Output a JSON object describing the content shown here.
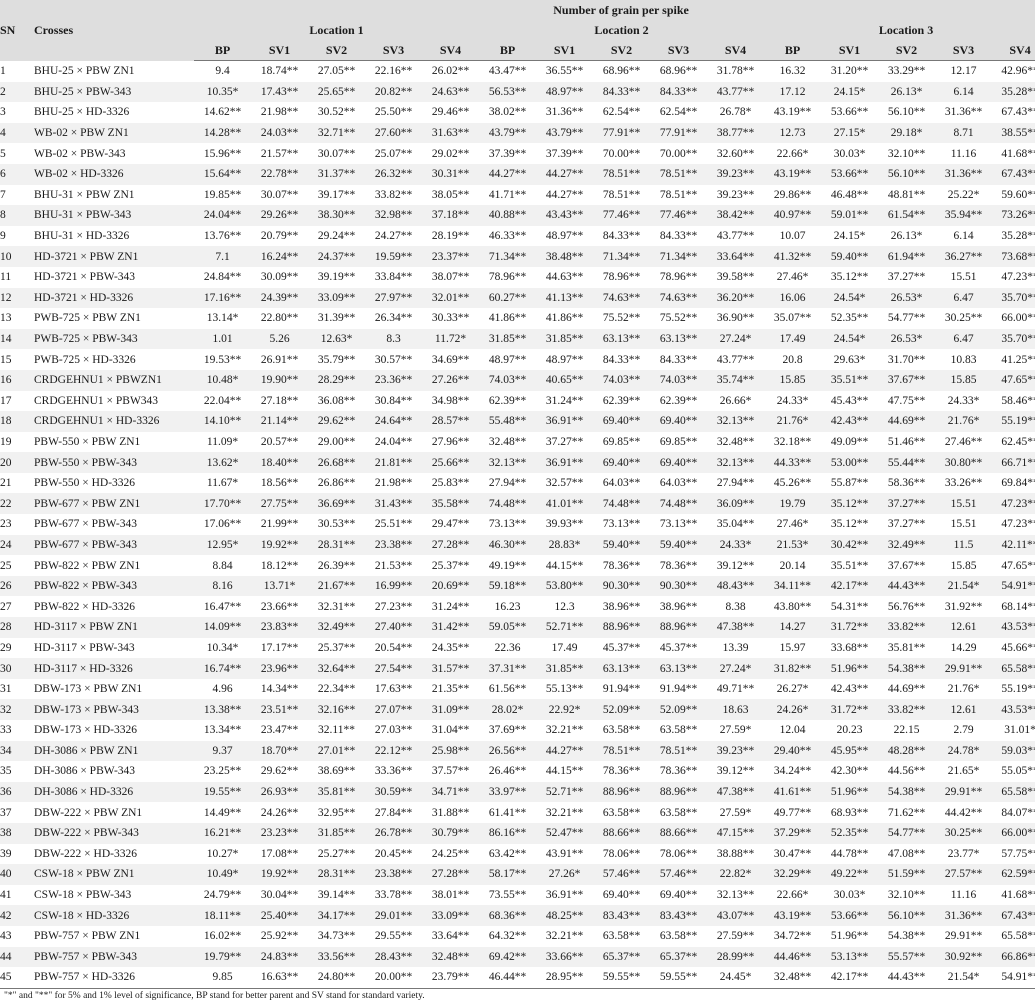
{
  "table": {
    "title": "Number of grain per spike",
    "sn_header": "SN",
    "crosses_header": "Crosses",
    "locations": [
      "Location 1",
      "Location 2",
      "Location 3"
    ],
    "columns": [
      "BP",
      "SV1",
      "SV2",
      "SV3",
      "SV4"
    ],
    "rows": [
      [
        "1",
        "BHU-25 × PBW ZN1",
        "9.4",
        "18.74**",
        "27.05**",
        "22.16**",
        "26.02**",
        "43.47**",
        "36.55**",
        "68.96**",
        "68.96**",
        "31.78**",
        "16.32",
        "31.20**",
        "33.29**",
        "12.17",
        "42.96**"
      ],
      [
        "2",
        "BHU-25 × PBW-343",
        "10.35*",
        "17.43**",
        "25.65**",
        "20.82**",
        "24.63**",
        "56.53**",
        "48.97**",
        "84.33**",
        "84.33**",
        "43.77**",
        "17.12",
        "24.15*",
        "26.13*",
        "6.14",
        "35.28**"
      ],
      [
        "3",
        "BHU-25 × HD-3326",
        "14.62**",
        "21.98**",
        "30.52**",
        "25.50**",
        "29.46**",
        "38.02**",
        "31.36**",
        "62.54**",
        "62.54**",
        "26.78*",
        "43.19**",
        "53.66**",
        "56.10**",
        "31.36**",
        "67.43**"
      ],
      [
        "4",
        "WB-02 × PBW ZN1",
        "14.28**",
        "24.03**",
        "32.71**",
        "27.60**",
        "31.63**",
        "43.79**",
        "43.79**",
        "77.91**",
        "77.91**",
        "38.77**",
        "12.73",
        "27.15*",
        "29.18*",
        "8.71",
        "38.55**"
      ],
      [
        "5",
        "WB-02 × PBW-343",
        "15.96**",
        "21.57**",
        "30.07**",
        "25.07**",
        "29.02**",
        "37.39**",
        "37.39**",
        "70.00**",
        "70.00**",
        "32.60**",
        "22.66*",
        "30.03*",
        "32.10**",
        "11.16",
        "41.68**"
      ],
      [
        "6",
        "WB-02 × HD-3326",
        "15.64**",
        "22.78**",
        "31.37**",
        "26.32**",
        "30.31**",
        "44.27**",
        "44.27**",
        "78.51**",
        "78.51**",
        "39.23**",
        "43.19**",
        "53.66**",
        "56.10**",
        "31.36**",
        "67.43**"
      ],
      [
        "7",
        "BHU-31 × PBW ZN1",
        "19.85**",
        "30.07**",
        "39.17**",
        "33.82**",
        "38.05**",
        "41.71**",
        "44.27**",
        "78.51**",
        "78.51**",
        "39.23**",
        "29.86**",
        "46.48**",
        "48.81**",
        "25.22*",
        "59.60**"
      ],
      [
        "8",
        "BHU-31 × PBW-343",
        "24.04**",
        "29.26**",
        "38.30**",
        "32.98**",
        "37.18**",
        "40.88**",
        "43.43**",
        "77.46**",
        "77.46**",
        "38.42**",
        "40.97**",
        "59.01**",
        "61.54**",
        "35.94**",
        "73.26**"
      ],
      [
        "9",
        "BHU-31 × HD-3326",
        "13.76**",
        "20.79**",
        "29.24**",
        "24.27**",
        "28.19**",
        "46.33**",
        "48.97**",
        "84.33**",
        "84.33**",
        "43.77**",
        "10.07",
        "24.15*",
        "26.13*",
        "6.14",
        "35.28**"
      ],
      [
        "10",
        "HD-3721 × PBW ZN1",
        "7.1",
        "16.24**",
        "24.37**",
        "19.59**",
        "23.37**",
        "71.34**",
        "38.48**",
        "71.34**",
        "71.34**",
        "33.64**",
        "41.32**",
        "59.40**",
        "61.94**",
        "36.27**",
        "73.68**"
      ],
      [
        "11",
        "HD-3721 × PBW-343",
        "24.84**",
        "30.09**",
        "39.19**",
        "33.84**",
        "38.07**",
        "78.96**",
        "44.63**",
        "78.96**",
        "78.96**",
        "39.58**",
        "27.46*",
        "35.12**",
        "37.27**",
        "15.51",
        "47.23**"
      ],
      [
        "12",
        "HD-3721 × HD-3326",
        "17.16**",
        "24.39**",
        "33.09**",
        "27.97**",
        "32.01**",
        "60.27**",
        "41.13**",
        "74.63**",
        "74.63**",
        "36.20**",
        "16.06",
        "24.54*",
        "26.53*",
        "6.47",
        "35.70**"
      ],
      [
        "13",
        "PWB-725 × PBW ZN1",
        "13.14*",
        "22.80**",
        "31.39**",
        "26.34**",
        "30.33**",
        "41.86**",
        "41.86**",
        "75.52**",
        "75.52**",
        "36.90**",
        "35.07**",
        "52.35**",
        "54.77**",
        "30.25**",
        "66.00**"
      ],
      [
        "14",
        "PWB-725 × PBW-343",
        "1.01",
        "5.26",
        "12.63*",
        "8.3",
        "11.72*",
        "31.85**",
        "31.85**",
        "63.13**",
        "63.13**",
        "27.24*",
        "17.49",
        "24.54*",
        "26.53*",
        "6.47",
        "35.70**"
      ],
      [
        "15",
        "PWB-725 × HD-3326",
        "19.53**",
        "26.91**",
        "35.79**",
        "30.57**",
        "34.69**",
        "48.97**",
        "48.97**",
        "84.33**",
        "84.33**",
        "43.77**",
        "20.8",
        "29.63*",
        "31.70**",
        "10.83",
        "41.25**"
      ],
      [
        "16",
        "CRDGEHNU1 × PBWZN1",
        "10.48*",
        "19.90**",
        "28.29**",
        "23.36**",
        "27.26**",
        "74.03**",
        "40.65**",
        "74.03**",
        "74.03**",
        "35.74**",
        "15.85",
        "35.51**",
        "37.67**",
        "15.85",
        "47.65**"
      ],
      [
        "17",
        "CRDGEHNU1 × PBW343",
        "22.04**",
        "27.18**",
        "36.08**",
        "30.84**",
        "34.98**",
        "62.39**",
        "31.24**",
        "62.39**",
        "62.39**",
        "26.66*",
        "24.33*",
        "45.43**",
        "47.75**",
        "24.33*",
        "58.46**"
      ],
      [
        "18",
        "CRDGEHNU1 × HD-3326",
        "14.10**",
        "21.14**",
        "29.62**",
        "24.64**",
        "28.57**",
        "55.48**",
        "36.91**",
        "69.40**",
        "69.40**",
        "32.13**",
        "21.76*",
        "42.43**",
        "44.69**",
        "21.76*",
        "55.19**"
      ],
      [
        "19",
        "PBW-550 × PBW ZN1",
        "11.09*",
        "20.57**",
        "29.00**",
        "24.04**",
        "27.96**",
        "32.48**",
        "37.27**",
        "69.85**",
        "69.85**",
        "32.48**",
        "32.18**",
        "49.09**",
        "51.46**",
        "27.46**",
        "62.45**"
      ],
      [
        "20",
        "PBW-550 × PBW-343",
        "13.62*",
        "18.40**",
        "26.68**",
        "21.81**",
        "25.66**",
        "32.13**",
        "36.91**",
        "69.40**",
        "69.40**",
        "32.13**",
        "44.33**",
        "53.00**",
        "55.44**",
        "30.80**",
        "66.71**"
      ],
      [
        "21",
        "PBW-550 × HD-3326",
        "11.67*",
        "18.56**",
        "26.86**",
        "21.98**",
        "25.83**",
        "27.94**",
        "32.57**",
        "64.03**",
        "64.03**",
        "27.94**",
        "45.26**",
        "55.87**",
        "58.36**",
        "33.26**",
        "69.84**"
      ],
      [
        "22",
        "PBW-677 × PBW ZN1",
        "17.70**",
        "27.75**",
        "36.69**",
        "31.43**",
        "35.58**",
        "74.48**",
        "41.01**",
        "74.48**",
        "74.48**",
        "36.09**",
        "19.79",
        "35.12**",
        "37.27**",
        "15.51",
        "47.23**"
      ],
      [
        "23",
        "PBW-677 × PBW-343",
        "17.06**",
        "21.99**",
        "30.53**",
        "25.51**",
        "29.47**",
        "73.13**",
        "39.93**",
        "73.13**",
        "73.13**",
        "35.04**",
        "27.46*",
        "35.12**",
        "37.27**",
        "15.51",
        "47.23**"
      ],
      [
        "24",
        "PBW-677 × PBW-343",
        "12.95*",
        "19.92**",
        "28.31**",
        "23.38**",
        "27.28**",
        "46.30**",
        "28.83*",
        "59.40**",
        "59.40**",
        "24.33*",
        "21.53*",
        "30.42**",
        "32.49**",
        "11.5",
        "42.11**"
      ],
      [
        "25",
        "PBW-822 × PBW ZN1",
        "8.84",
        "18.12**",
        "26.39**",
        "21.53**",
        "25.37**",
        "49.19**",
        "44.15**",
        "78.36**",
        "78.36**",
        "39.12**",
        "20.14",
        "35.51**",
        "37.67**",
        "15.85",
        "47.65**"
      ],
      [
        "26",
        "PBW-822 × PBW-343",
        "8.16",
        "13.71*",
        "21.67**",
        "16.99**",
        "20.69**",
        "59.18**",
        "53.80**",
        "90.30**",
        "90.30**",
        "48.43**",
        "34.11**",
        "42.17**",
        "44.43**",
        "21.54*",
        "54.91**"
      ],
      [
        "27",
        "PBW-822 × HD-3326",
        "16.47**",
        "23.66**",
        "32.31**",
        "27.23**",
        "31.24**",
        "16.23",
        "12.3",
        "38.96**",
        "38.96**",
        "8.38",
        "43.80**",
        "54.31**",
        "56.76**",
        "31.92**",
        "68.14**"
      ],
      [
        "28",
        "HD-3117 × PBW ZN1",
        "14.09**",
        "23.83**",
        "32.49**",
        "27.40**",
        "31.42**",
        "59.05**",
        "52.71**",
        "88.96**",
        "88.96**",
        "47.38**",
        "14.27",
        "31.72**",
        "33.82**",
        "12.61",
        "43.53**"
      ],
      [
        "29",
        "HD-3117 × PBW-343",
        "10.34*",
        "17.17**",
        "25.37**",
        "20.54**",
        "24.35**",
        "22.36",
        "17.49",
        "45.37**",
        "45.37**",
        "13.39",
        "15.97",
        "33.68**",
        "35.81**",
        "14.29",
        "45.66**"
      ],
      [
        "30",
        "HD-3117 × HD-3326",
        "16.74**",
        "23.96**",
        "32.64**",
        "27.54**",
        "31.57**",
        "37.31**",
        "31.85**",
        "63.13**",
        "63.13**",
        "27.24*",
        "31.82**",
        "51.96**",
        "54.38**",
        "29.91**",
        "65.58**"
      ],
      [
        "31",
        "DBW-173 × PBW ZN1",
        "4.96",
        "14.34**",
        "22.34**",
        "17.63**",
        "21.35**",
        "61.56**",
        "55.13**",
        "91.94**",
        "91.94**",
        "49.71**",
        "26.27*",
        "42.43**",
        "44.69**",
        "21.76*",
        "55.19**"
      ],
      [
        "32",
        "DBW-173 × PBW-343",
        "13.38**",
        "23.51**",
        "32.16**",
        "27.07**",
        "31.09**",
        "28.02*",
        "22.92*",
        "52.09**",
        "52.09**",
        "18.63",
        "24.26*",
        "31.72**",
        "33.82**",
        "12.61",
        "43.53**"
      ],
      [
        "33",
        "DBW-173 × HD-3326",
        "13.34**",
        "23.47**",
        "32.11**",
        "27.03**",
        "31.04**",
        "37.69**",
        "32.21**",
        "63.58**",
        "63.58**",
        "27.59*",
        "12.04",
        "20.23",
        "22.15",
        "2.79",
        "31.01*"
      ],
      [
        "34",
        "DH-3086 × PBW ZN1",
        "9.37",
        "18.70**",
        "27.01**",
        "22.12**",
        "25.98**",
        "26.56**",
        "44.27**",
        "78.51**",
        "78.51**",
        "39.23**",
        "29.40**",
        "45.95**",
        "48.28**",
        "24.78*",
        "59.03**"
      ],
      [
        "35",
        "DH-3086 × PBW-343",
        "23.25**",
        "29.62**",
        "38.69**",
        "33.36**",
        "37.57**",
        "26.46**",
        "44.15**",
        "78.36**",
        "78.36**",
        "39.12**",
        "34.24**",
        "42.30**",
        "44.56**",
        "21.65*",
        "55.05**"
      ],
      [
        "36",
        "DH-3086 × HD-3326",
        "19.55**",
        "26.93**",
        "35.81**",
        "30.59**",
        "34.71**",
        "33.97**",
        "52.71**",
        "88.96**",
        "88.96**",
        "47.38**",
        "41.61**",
        "51.96**",
        "54.38**",
        "29.91**",
        "65.58**"
      ],
      [
        "37",
        "DBW-222 × PBW ZN1",
        "14.49**",
        "24.26**",
        "32.95**",
        "27.84**",
        "31.88**",
        "61.41**",
        "32.21**",
        "63.58**",
        "63.58**",
        "27.59*",
        "49.77**",
        "68.93**",
        "71.62**",
        "44.42**",
        "84.07**"
      ],
      [
        "38",
        "DBW-222 × PBW-343",
        "16.21**",
        "23.23**",
        "31.85**",
        "26.78**",
        "30.79**",
        "86.16**",
        "52.47**",
        "88.66**",
        "88.66**",
        "47.15**",
        "37.29**",
        "52.35**",
        "54.77**",
        "30.25**",
        "66.00**"
      ],
      [
        "39",
        "DBW-222 × HD-3326",
        "10.27*",
        "17.08**",
        "25.27**",
        "20.45**",
        "24.25**",
        "63.42**",
        "43.91**",
        "78.06**",
        "78.06**",
        "38.88**",
        "30.47**",
        "44.78**",
        "47.08**",
        "23.77*",
        "57.75**"
      ],
      [
        "40",
        "CSW-18 × PBW ZN1",
        "10.49*",
        "19.92**",
        "28.31**",
        "23.38**",
        "27.28**",
        "58.17**",
        "27.26*",
        "57.46**",
        "57.46**",
        "22.82*",
        "32.29**",
        "49.22**",
        "51.59**",
        "27.57**",
        "62.59**"
      ],
      [
        "41",
        "CSW-18 × PBW-343",
        "24.79**",
        "30.04**",
        "39.14**",
        "33.78**",
        "38.01**",
        "73.55**",
        "36.91**",
        "69.40**",
        "69.40**",
        "32.13**",
        "22.66*",
        "30.03*",
        "32.10**",
        "11.16",
        "41.68**"
      ],
      [
        "42",
        "CSW-18 × HD-3326",
        "18.11**",
        "25.40**",
        "34.17**",
        "29.01**",
        "33.09**",
        "68.36**",
        "48.25**",
        "83.43**",
        "83.43**",
        "43.07**",
        "43.19**",
        "53.66**",
        "56.10**",
        "31.36**",
        "67.43**"
      ],
      [
        "43",
        "PBW-757 × PBW ZN1",
        "16.02**",
        "25.92**",
        "34.73**",
        "29.55**",
        "33.64**",
        "64.32**",
        "32.21**",
        "63.58**",
        "63.58**",
        "27.59**",
        "34.72**",
        "51.96**",
        "54.38**",
        "29.91**",
        "65.58**"
      ],
      [
        "44",
        "PBW-757 × PBW-343",
        "19.79**",
        "24.83**",
        "33.56**",
        "28.43**",
        "32.48**",
        "69.42**",
        "33.66**",
        "65.37**",
        "65.37**",
        "28.99**",
        "44.46**",
        "53.13**",
        "55.57**",
        "30.92**",
        "66.86**"
      ],
      [
        "45",
        "PBW-757 × HD-3326",
        "9.85",
        "16.63**",
        "24.80**",
        "20.00**",
        "23.79**",
        "46.44**",
        "28.95**",
        "59.55**",
        "59.55**",
        "24.45*",
        "32.48**",
        "42.17**",
        "44.43**",
        "21.54*",
        "54.91**"
      ]
    ]
  },
  "footnote": "\"*\" and \"**\" for 5% and 1% level of significance, BP stand for better parent and SV stand for standard variety."
}
